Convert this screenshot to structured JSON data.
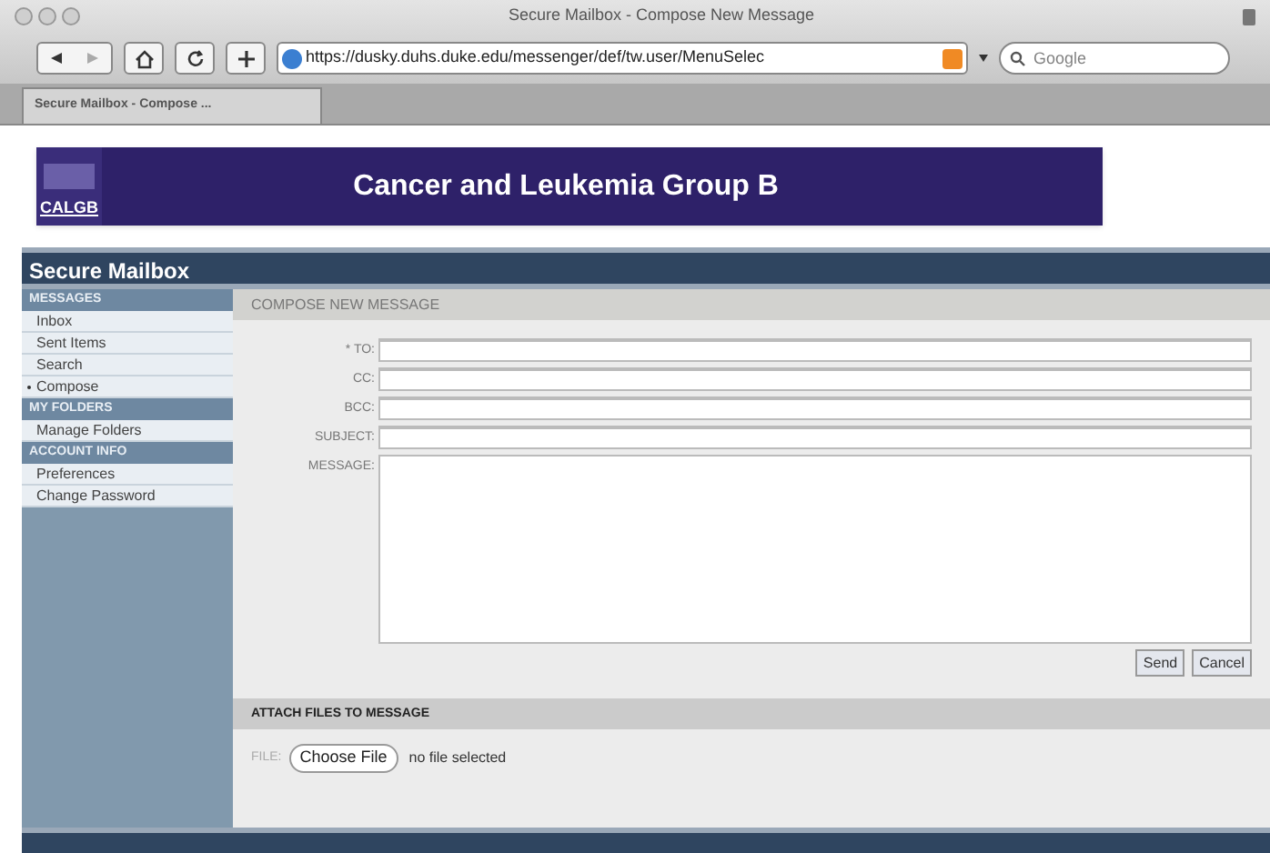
{
  "window": {
    "title": "Secure Mailbox - Compose New Message",
    "url": "https://dusky.duhs.duke.edu/messenger/def/tw.user/MenuSelec",
    "search_placeholder": "Google"
  },
  "tabs": [
    {
      "label": "Secure Mailbox - Compose ...",
      "selected": true
    }
  ],
  "banner": {
    "logo": "CALGB",
    "title": "Cancer and Leukemia Group B"
  },
  "app_title": "Secure Mailbox",
  "sidebar": [
    {
      "heading": "MESSAGES",
      "items": [
        {
          "label": "Inbox",
          "selected": false
        },
        {
          "label": "Sent Items",
          "selected": false
        },
        {
          "label": "Search",
          "selected": false
        },
        {
          "label": "Compose",
          "selected": true
        }
      ]
    },
    {
      "heading": "MY FOLDERS",
      "items": [
        {
          "label": "Manage Folders",
          "selected": false
        }
      ]
    },
    {
      "heading": "ACCOUNT INFO",
      "items": [
        {
          "label": "Preferences",
          "selected": false
        },
        {
          "label": "Change Password",
          "selected": false
        }
      ]
    }
  ],
  "compose": {
    "heading": "COMPOSE NEW MESSAGE",
    "fields": [
      {
        "label": "* TO:",
        "kind": "line"
      },
      {
        "label": "CC:",
        "kind": "line"
      },
      {
        "label": "BCC:",
        "kind": "line"
      },
      {
        "label": "SUBJECT:",
        "kind": "line"
      },
      {
        "label": "MESSAGE:",
        "kind": "area"
      }
    ],
    "buttons": [
      "Send",
      "Cancel"
    ]
  },
  "attach": {
    "heading": "ATTACH FILES TO MESSAGE",
    "label": "FILE:",
    "button": "Choose File",
    "status": "no file selected"
  }
}
